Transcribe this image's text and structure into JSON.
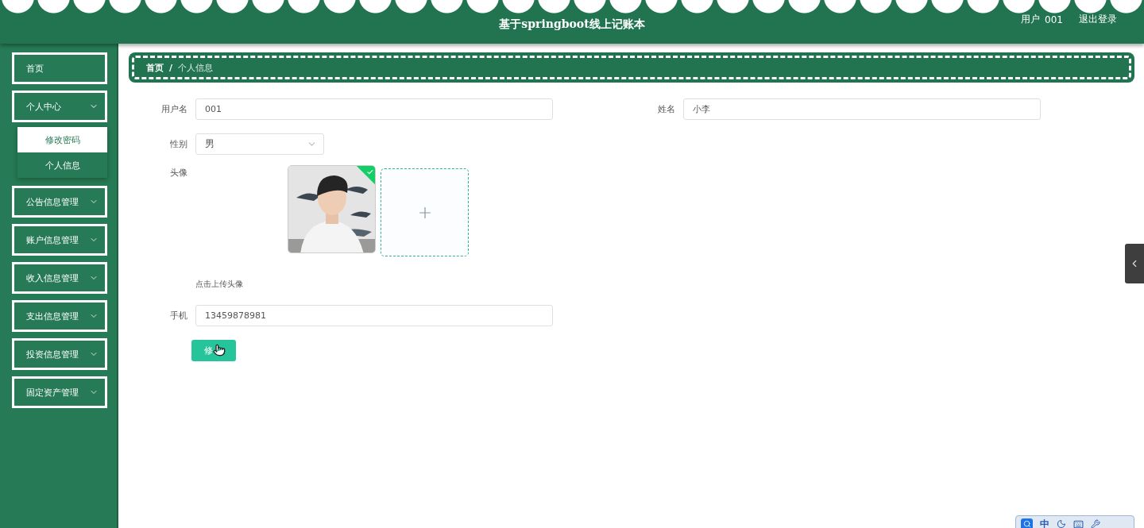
{
  "header": {
    "title": "基于springboot线上记账本",
    "user_label": "用户",
    "user_name": "001",
    "logout": "退出登录"
  },
  "sidebar": {
    "items": [
      {
        "label": "首页",
        "kind": "link"
      },
      {
        "label": "个人中心",
        "kind": "menu",
        "expanded": true,
        "children": [
          {
            "label": "修改密码",
            "selected": true
          },
          {
            "label": "个人信息",
            "selected": false
          }
        ]
      },
      {
        "label": "公告信息管理",
        "kind": "menu",
        "expanded": false
      },
      {
        "label": "账户信息管理",
        "kind": "menu",
        "expanded": false
      },
      {
        "label": "收入信息管理",
        "kind": "menu",
        "expanded": false
      },
      {
        "label": "支出信息管理",
        "kind": "menu",
        "expanded": false
      },
      {
        "label": "投资信息管理",
        "kind": "menu",
        "expanded": false
      },
      {
        "label": "固定资产管理",
        "kind": "menu",
        "expanded": false
      }
    ]
  },
  "breadcrumb": {
    "items": [
      {
        "label": "首页",
        "current": false
      },
      {
        "label": "个人信息",
        "current": true
      }
    ],
    "separator": "/"
  },
  "form": {
    "username": {
      "label": "用户名",
      "value": "001"
    },
    "name": {
      "label": "姓名",
      "value": "小李"
    },
    "gender": {
      "label": "性别",
      "value": "男"
    },
    "avatar": {
      "label": "头像",
      "uploaded": true,
      "hint": "点击上传头像"
    },
    "phone": {
      "label": "手机",
      "value": "13459878981"
    },
    "submit": "修"
  },
  "ime": {
    "mode": "中"
  }
}
